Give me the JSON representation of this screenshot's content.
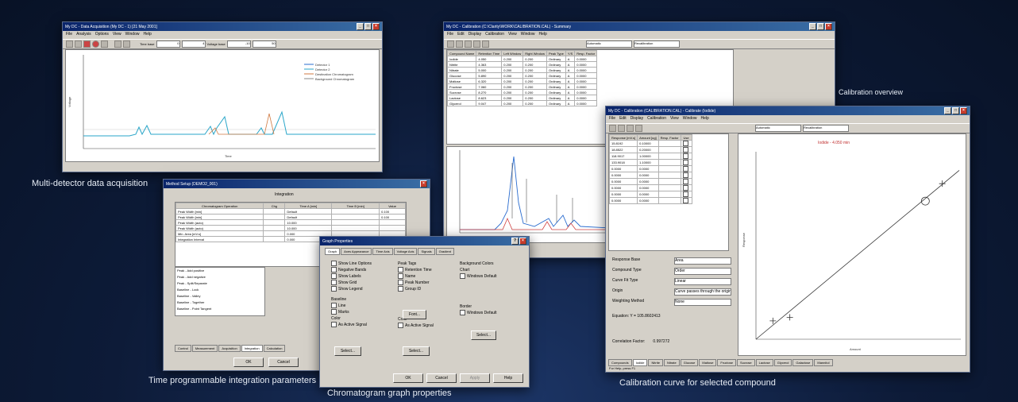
{
  "captions": {
    "multi_detector": "Multi-detector data acquisition",
    "calibration_overview": "Calibration overview",
    "integration_params": "Time programmable integration parameters",
    "graph_properties": "Chromatogram graph properties",
    "calibration_curve": "Calibration curve for selected compound"
  },
  "acq_window": {
    "title": "My DC - Data Acquisition (My DC - 1) [21 May 2001]",
    "menu": [
      "File",
      "Analysis",
      "Options",
      "View",
      "Window",
      "Help"
    ],
    "time_base_label": "Time base",
    "time_from": "0",
    "time_to": "4",
    "voltage_label": "Voltage base",
    "voltage_from": "-10",
    "voltage_to": "50",
    "legend": [
      "Detector 1",
      "Detector 2",
      "Destination Chromatogram",
      "Background Chromatogram"
    ],
    "xlabel": "Time",
    "ylabel": "Voltage"
  },
  "integration_window": {
    "title": "Method Setup (DEMO2_001)",
    "header": "Integration",
    "columns": [
      "Chromatogram Operation",
      "Chg",
      "Time A [min]",
      "Time B [min]",
      "Value"
    ],
    "rows": [
      "Peak Width [min]",
      "Peak Width [min]",
      "Peak Width (auto)",
      "Peak Width (auto)",
      "Min. Area [mV.s]",
      "Integration Interval"
    ],
    "events": [
      "Peak - Add positive",
      "Peak - Add negative",
      "Peak - Split/Separate",
      "Baseline - Lock",
      "Baseline - Valley",
      "Baseline - Together",
      "Baseline - Point Tangent"
    ],
    "tabs": [
      "Control",
      "Measurement",
      "Acquisition",
      "Integration",
      "Calculation"
    ],
    "ok": "OK",
    "cancel": "Cancel"
  },
  "graph_window": {
    "title": "Graph Properties",
    "tabs": [
      "Graph",
      "Axes Appearance",
      "Time Axis",
      "Voltage Axis",
      "Signals",
      "Gradient"
    ],
    "group1": [
      "Show Line Options",
      "Negative Bands",
      "Show Labels",
      "Show Grid",
      "Show Legend"
    ],
    "peak_tags_label": "Peak Tags",
    "peak_tags": [
      "Retention Time",
      "Name",
      "Peak Number",
      "Group ID"
    ],
    "background_label": "Background Colors",
    "chart_label": "Chart",
    "windows_default": "Windows Default",
    "baseline_label": "Baseline",
    "baseline_opts": [
      "Line",
      "Marks"
    ],
    "color_label": "Color",
    "as_active": "As Active Signal",
    "font": "Font...",
    "select": "Select...",
    "border_label": "Border",
    "ok": "OK",
    "cancel": "Cancel",
    "apply": "Apply",
    "help": "Help"
  },
  "calib_window": {
    "title": "My DC - Calibration (C:\\Clarity\\WORK\\CALIBRATION.CAL) - Summary",
    "menu": [
      "File",
      "Edit",
      "Display",
      "Calibration",
      "View",
      "Window",
      "Help"
    ],
    "mode": "Automatic",
    "recal": "Recalibration",
    "columns": [
      "Compound Name",
      "Retention Time",
      "Left Window",
      "Right Window",
      "Peak Type",
      "Y/S",
      "Resp. Factor"
    ],
    "compounds": [
      "Iodide",
      "Nitrite",
      "Nitrate",
      "Glucose",
      "Maltose",
      "Fructose",
      "Sucrose",
      "Lactose",
      "Glycerol"
    ],
    "retention": [
      "4.050",
      "4.363",
      "5.000",
      "5.890",
      "6.320",
      "7.060",
      "8.270",
      "8.623",
      "9.047"
    ],
    "bottom_tabs": [
      "Iodide",
      "Nitrite",
      "Nitrate",
      "Glucose",
      "Maltose"
    ]
  },
  "curve_window": {
    "title": "My DC - Calibration (CALIBRATION.CAL) - Calibrate (Iodide)",
    "mode": "Automatic",
    "recal": "Recalibration",
    "columns": [
      "Response [mV.s]",
      "Amount [ug]",
      "Resp. Factor",
      "Use"
    ],
    "responses": [
      "15.8192",
      "18.8522",
      "118.9017",
      "133.9018",
      "0.0000",
      "0.0000",
      "0.0000",
      "0.0000",
      "0.0000",
      "0.0000"
    ],
    "amounts": [
      "0.10000",
      "0.20000",
      "1.00000",
      "1.10000",
      "0.0000",
      "0.0000",
      "0.0000",
      "0.0000",
      "0.0000",
      "0.0000"
    ],
    "chart_title": "Iodide - 4.050 min",
    "props": [
      {
        "label": "Response Base",
        "value": "Area"
      },
      {
        "label": "Compound Type",
        "value": "Order"
      },
      {
        "label": "Curve Fit Type",
        "value": "Linear"
      },
      {
        "label": "Origin",
        "value": "Curve passes through the origin"
      },
      {
        "label": "Weighting Method",
        "value": "None"
      }
    ],
    "equation": "Equation:  Y = 105.8602413",
    "corr": "Correlation Factor:",
    "corr_val": "0.997272",
    "status": "For Help, press F1",
    "tabs": [
      "Compounds",
      "Iodide",
      "Nitrite",
      "Nitrate",
      "Glucose",
      "Maltose",
      "Fructose",
      "Sucrose",
      "Lactose",
      "Glycerol",
      "Galactose",
      "Mannitol"
    ],
    "xlabel": "Amount",
    "ylabel": "Response"
  },
  "chart_data": [
    {
      "type": "scatter",
      "title": "Iodide - 4.050 min",
      "xlabel": "Amount",
      "ylabel": "Response",
      "series": [
        {
          "name": "points",
          "x": [
            0.1,
            0.2,
            1.1
          ],
          "y": [
            15.8,
            18.9,
            133.9
          ]
        },
        {
          "name": "outlier",
          "x": [
            1.0
          ],
          "y": [
            118.9
          ]
        }
      ],
      "xlim": [
        0,
        1.2
      ],
      "ylim": [
        0,
        160
      ]
    }
  ]
}
